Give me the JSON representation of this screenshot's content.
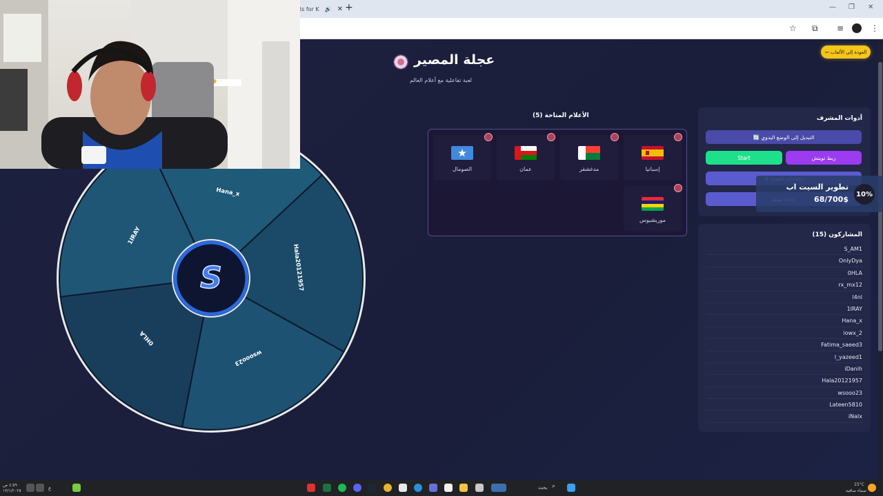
{
  "browser": {
    "tab_partial": "ts for K",
    "close_glyph": "✕",
    "newtab_glyph": "+"
  },
  "page": {
    "back_button": "⇦ العودة إلى الألعاب",
    "title": "عجلة المصير",
    "subtitle": "لعبة تفاعلية مع أعلام العالم",
    "flags_title": "الأعلام المتاحة (5)",
    "flags": [
      {
        "label": "إسبانيا",
        "flag": "spain"
      },
      {
        "label": "مدغشقر",
        "flag": "madagascar"
      },
      {
        "label": "عمان",
        "flag": "oman"
      },
      {
        "label": "الصومال",
        "flag": "somalia"
      },
      {
        "label": "موريشيوس",
        "flag": "mauritius"
      }
    ],
    "admin": {
      "title": "أدوات المشرف",
      "manual_mode": "🔄 التبديل إلى الوضع اليدوي",
      "twitch_link": "ربط تويتش",
      "start_label": "Start",
      "settings": "⚙ إعدادات العجلة",
      "reset": "إعادة ضبط"
    },
    "overlay": {
      "title": "تطوير السيت اب",
      "amount": "68/700$",
      "percent": "10%"
    },
    "participants_title": "المشاركون (15)",
    "participants": [
      "S_AM1",
      "OnlyDya",
      "0HLA",
      "rx_mx12",
      "l4nl",
      "1IRAY",
      "Hana_x",
      "iowx_2",
      "Fatima_saeed3",
      "I_yazeed1",
      "iDanih",
      "Hala20121957",
      "wsooo23",
      "Lateen5810",
      "iNalx"
    ],
    "wheel": {
      "segments": [
        "Hana_x",
        "Hala20121957",
        "wsooo23",
        "0HLA",
        "1IRAY"
      ],
      "center_logo": "S"
    }
  },
  "taskbar": {
    "search": "بحث",
    "weather": "15°C",
    "weather_desc": "سماء صافية",
    "time": "٤:٥٩ ص",
    "date": "١٣/١/٢٠٢٥",
    "lang": "ع"
  }
}
